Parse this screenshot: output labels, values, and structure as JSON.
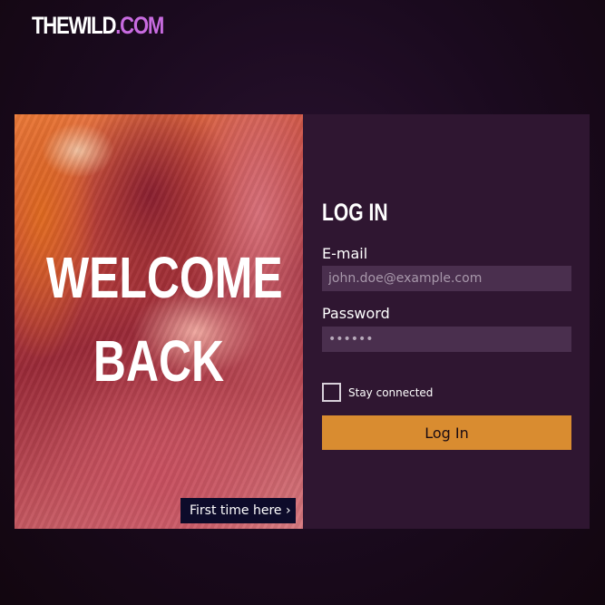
{
  "header": {
    "logo_brand": "THEWILD",
    "logo_tld": ".COM"
  },
  "hero": {
    "title_line1": "WELCOME",
    "title_line2": "BACK",
    "first_time_link": "First time here ›"
  },
  "login": {
    "title": "LOG IN",
    "email_label": "E-mail",
    "email_placeholder": "john.doe@example.com",
    "password_label": "Password",
    "password_value": "••••••",
    "stay_connected_label": "Stay connected",
    "stay_connected_checked": false,
    "submit_label": "Log In"
  },
  "colors": {
    "accent": "#d98c30",
    "brand_tld": "#c86be0",
    "panel": "#2f1631",
    "input_bg": "#4a2f4e",
    "link_bg": "#0d0b2a"
  }
}
